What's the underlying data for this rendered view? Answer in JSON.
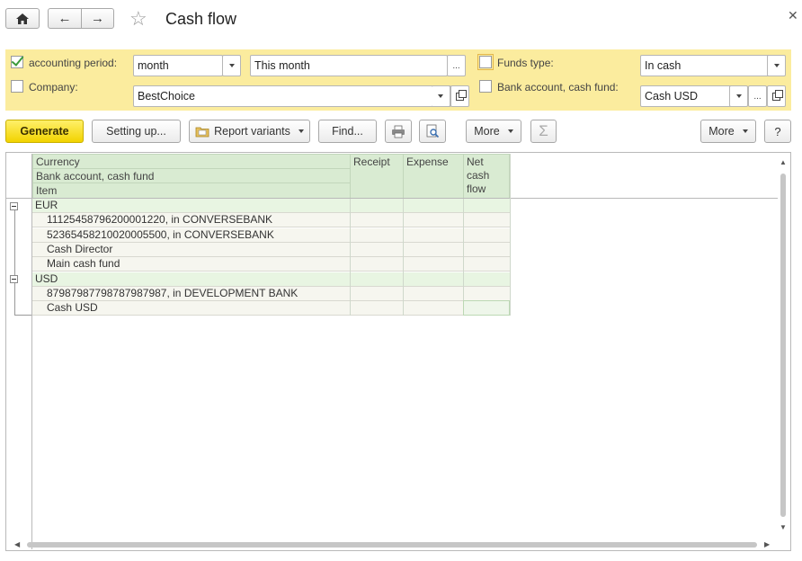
{
  "window": {
    "title": "Cash flow"
  },
  "filters": {
    "period_label": "accounting period:",
    "period_unit": "month",
    "period_value": "This month",
    "company_label": "Company:",
    "company_value": "BestChoice",
    "funds_type_label": "Funds type:",
    "funds_type_value": "In cash",
    "bank_label": "Bank account, cash fund:",
    "bank_value": "Cash USD",
    "ellipsis": "..."
  },
  "toolbar": {
    "generate": "Generate",
    "setting_up": "Setting up...",
    "report_variants": "Report variants",
    "find": "Find...",
    "more1": "More",
    "more2": "More",
    "help": "?",
    "sum": "Σ"
  },
  "grid": {
    "headers": {
      "currency": "Currency",
      "bank": "Bank account, cash fund",
      "item": "Item",
      "receipt": "Receipt",
      "expense": "Expense",
      "net_line1": "Net",
      "net_line2": "cash",
      "net_line3": "flow"
    },
    "rows": [
      {
        "label": "EUR",
        "group": true
      },
      {
        "label": "11125458796200001220, in CONVERSEBANK",
        "group": false
      },
      {
        "label": "52365458210020005500, in CONVERSEBANK",
        "group": false
      },
      {
        "label": "Cash Director",
        "group": false
      },
      {
        "label": "Main cash fund",
        "group": false
      },
      {
        "label": "USD",
        "group": true
      },
      {
        "label": "87987987798787987987, in DEVELOPMENT BANK",
        "group": false
      },
      {
        "label": "Cash USD",
        "group": false
      }
    ]
  }
}
